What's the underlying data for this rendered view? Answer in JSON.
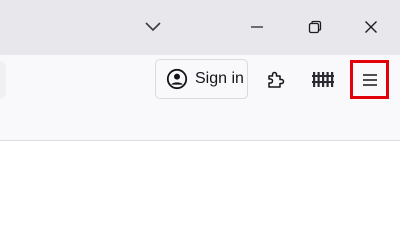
{
  "toolbar": {
    "signin_label": "Sign in"
  },
  "icons": {
    "tabs_dropdown": "chevron-down-icon",
    "minimize": "minimize-icon",
    "restore": "restore-icon",
    "close": "close-icon",
    "account": "account-icon",
    "extensions": "puzzle-icon",
    "fence": "fence-icon",
    "menu": "hamburger-menu-icon"
  },
  "colors": {
    "highlight": "#e3000b",
    "titlebar": "#e8e8ec",
    "toolbar": "#f9f9fb"
  }
}
